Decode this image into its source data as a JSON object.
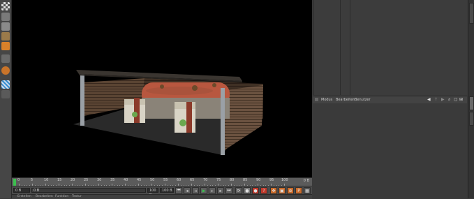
{
  "toolbar": {
    "tools": [
      "checker-tool",
      "stack-tool",
      "box-tool",
      "box-tool-2",
      "cube-tool",
      "shelf-tool",
      "pattern-tool",
      "hook-tool",
      "sphere-tool",
      "grid-tool"
    ]
  },
  "timeline": {
    "ticks": [
      "0",
      "5",
      "10",
      "15",
      "20",
      "25",
      "30",
      "35",
      "40",
      "45",
      "50",
      "55",
      "60",
      "65",
      "70",
      "75",
      "80",
      "85",
      "90",
      "95",
      "100"
    ],
    "current_frame": "0 B"
  },
  "transport": {
    "start_field": "0 B",
    "current_field": "0 B",
    "end_field": "100 B",
    "max_field": "100 B"
  },
  "attributes": {
    "menu": [
      "Modus",
      "Bearbeiten",
      "Benutzer"
    ]
  },
  "bottom_bar": {
    "labels": [
      "Erstellen",
      "Bearbeiten",
      "Funktion",
      "Textur"
    ]
  },
  "colors": {
    "accent": "#1e90ff",
    "play_green": "#3cbf4f",
    "record_red": "#c0392b"
  }
}
